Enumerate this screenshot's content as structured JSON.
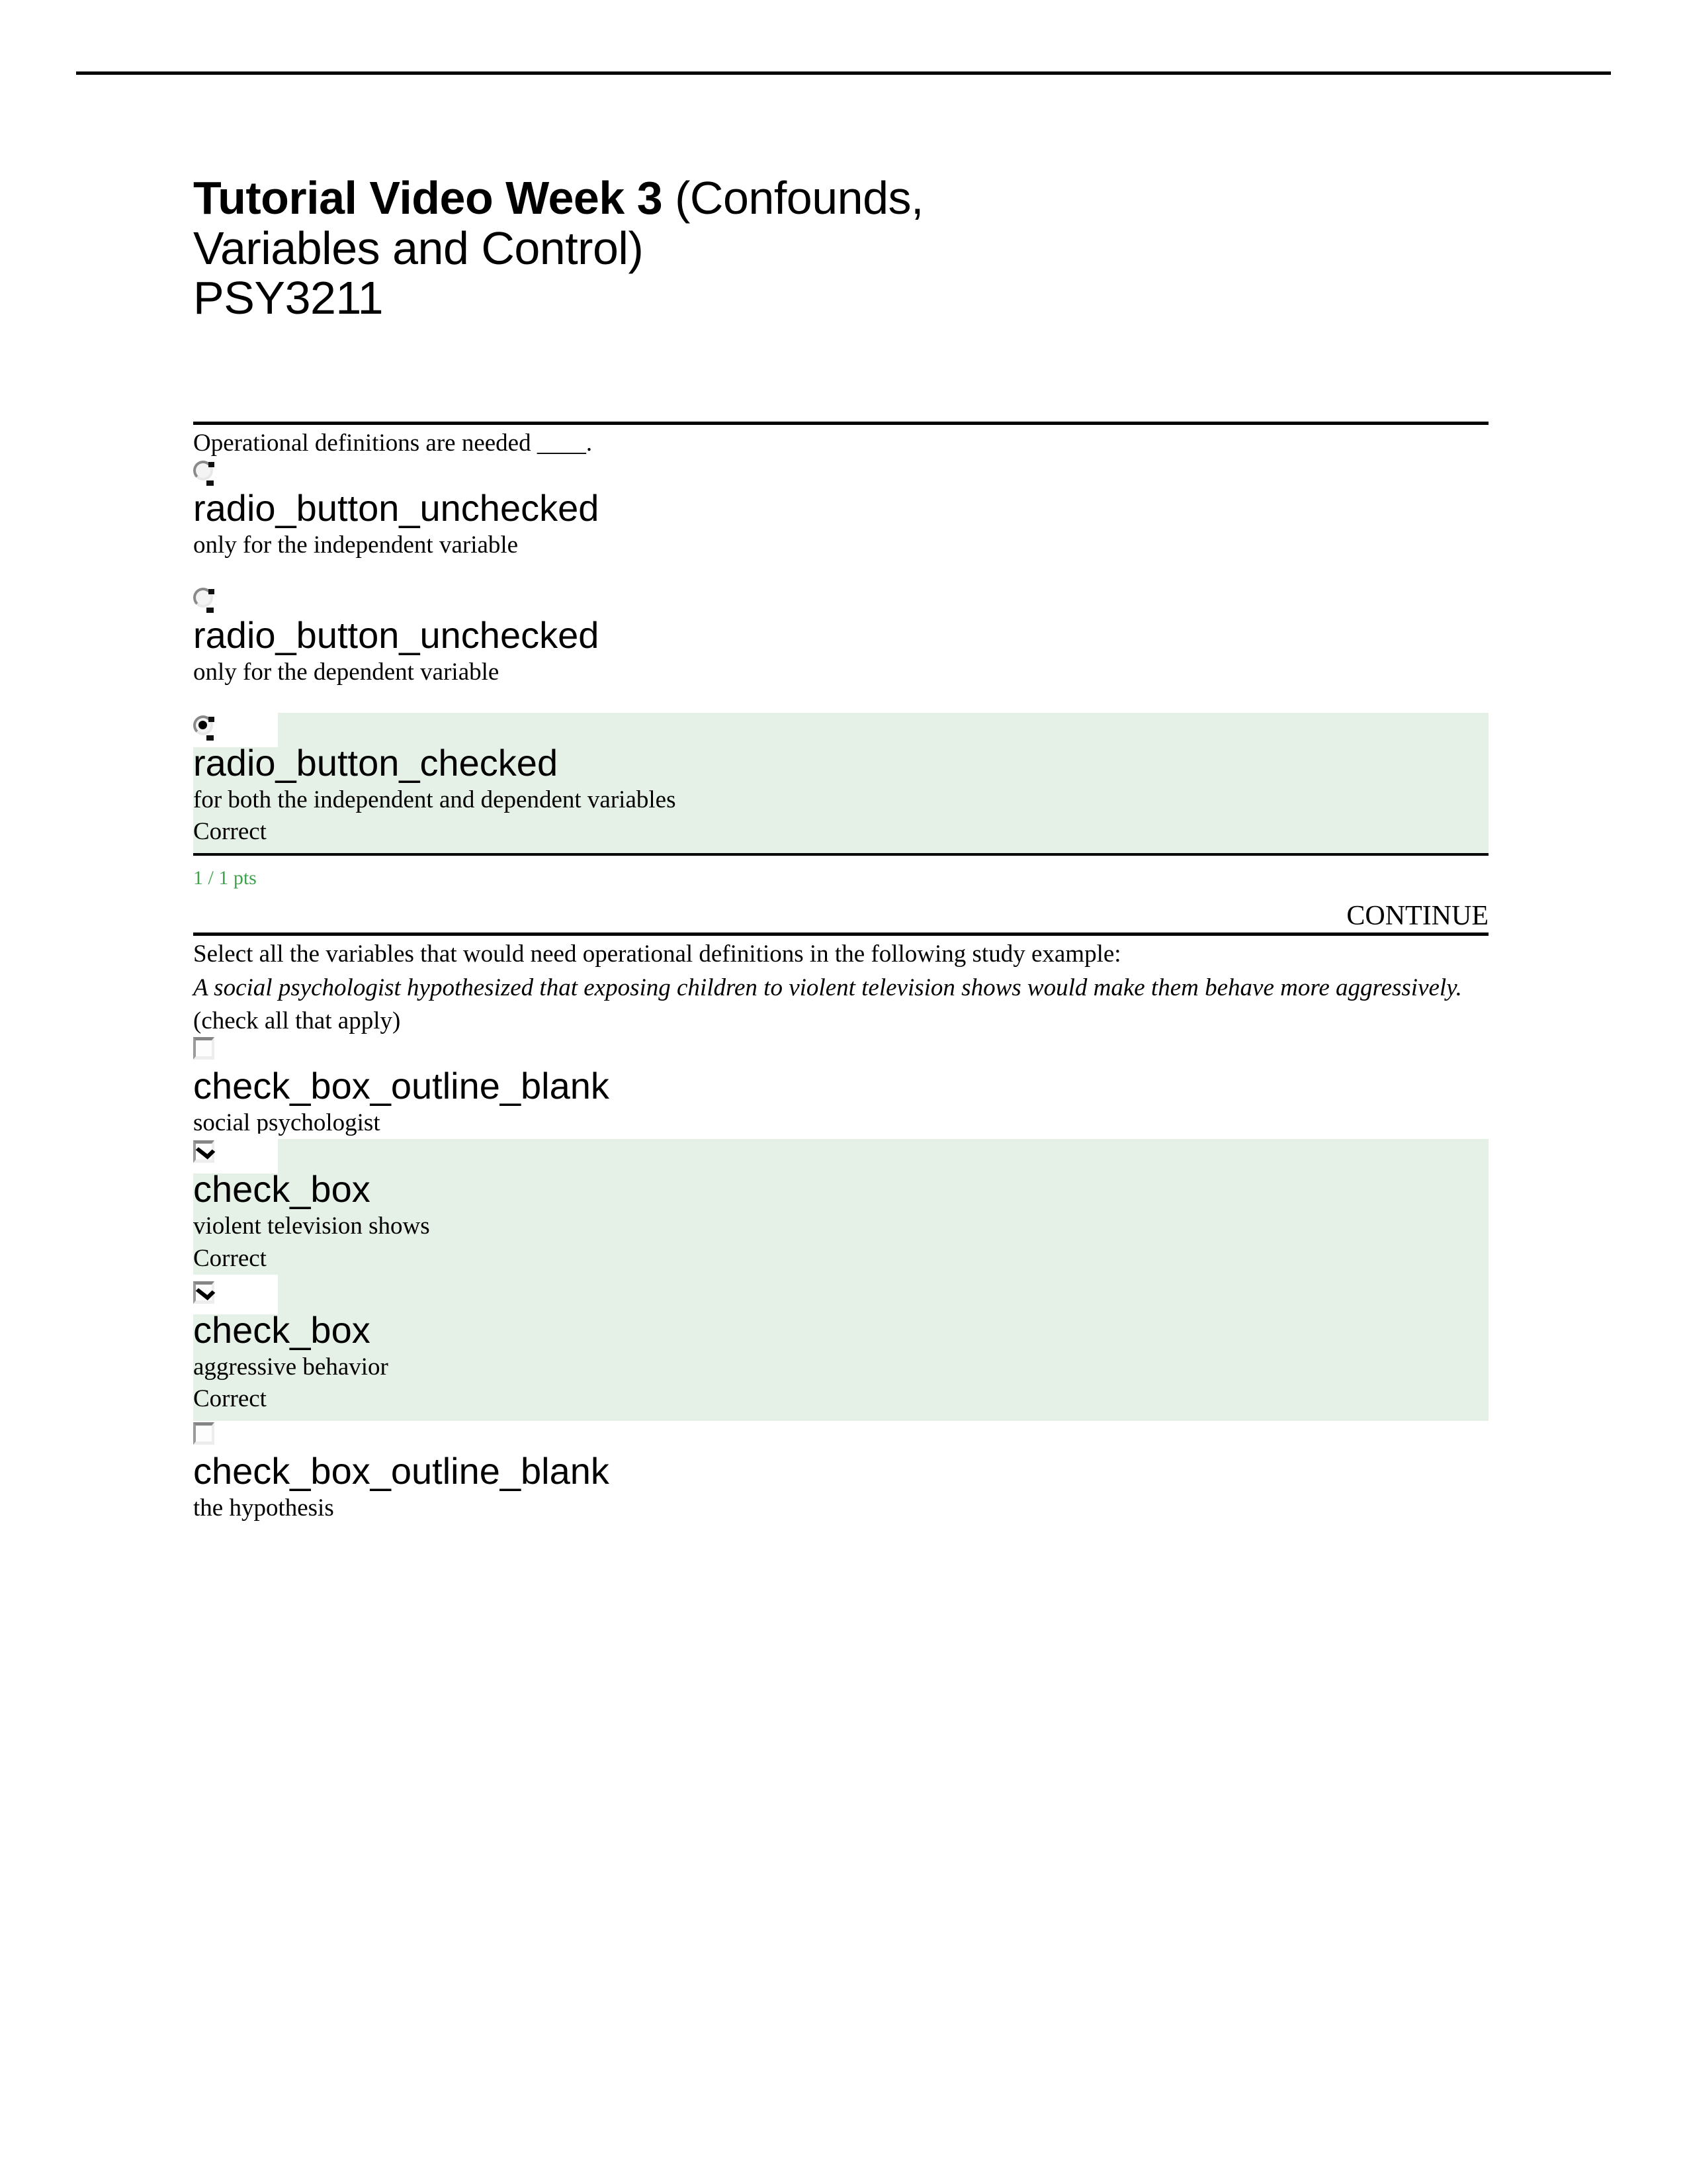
{
  "document": {
    "title_bold": "Tutorial Video Week 3",
    "title_rest": " (Confounds,",
    "title_line2": "Variables and Control)",
    "title_line3": "PSY3211"
  },
  "colors": {
    "correct_highlight": "#E5F0E6",
    "points_green": "#3FA34D",
    "rule": "#000000"
  },
  "questions": [
    {
      "prompt": "Operational definitions are needed ____.",
      "points": "1 / 1 pts",
      "continue_label": "CONTINUE",
      "options": [
        {
          "control_glyph": "radio_button_unchecked",
          "text": "only for the independent variable",
          "feedback": "",
          "selected": false
        },
        {
          "control_glyph": "radio_button_unchecked",
          "text": "only for the dependent variable",
          "feedback": "",
          "selected": false
        },
        {
          "control_glyph": "radio_button_checked",
          "text": "for both the independent and dependent variables",
          "feedback": "Correct",
          "selected": true
        }
      ]
    },
    {
      "prompt_line1": "Select all the variables that would need operational definitions in the following study example:",
      "prompt_line2": "A social psychologist hypothesized that exposing children to violent television shows would make them behave more aggressively.",
      "prompt_line3": "(check all that apply)",
      "options": [
        {
          "control_glyph": "check_box_outline_blank",
          "text": "social psychologist",
          "feedback": "",
          "selected": false
        },
        {
          "control_glyph": "check_box",
          "text": "violent television shows",
          "feedback": "Correct",
          "selected": true
        },
        {
          "control_glyph": "check_box",
          "text": "aggressive behavior",
          "feedback": "Correct",
          "selected": true
        },
        {
          "control_glyph": "check_box_outline_blank",
          "text": "the hypothesis",
          "feedback": "",
          "selected": false
        }
      ]
    }
  ]
}
